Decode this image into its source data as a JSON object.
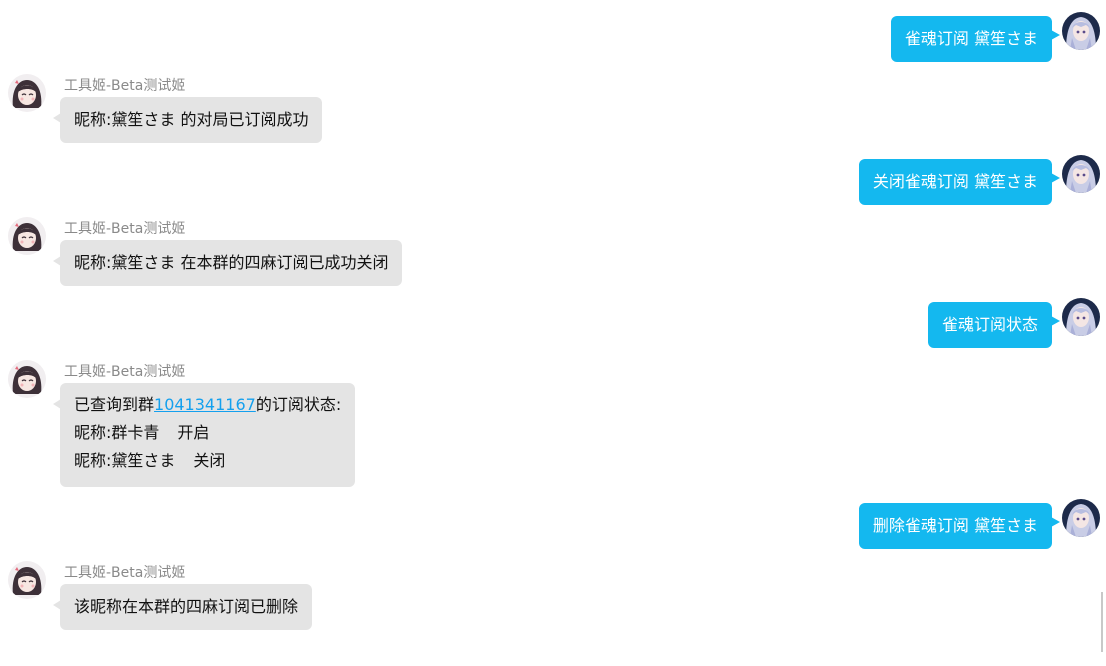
{
  "messages": [
    {
      "dir": "out",
      "text": "雀魂订阅 黛笙さま"
    },
    {
      "dir": "in",
      "sender": "工具姬-Beta测试姬",
      "text": "昵称:黛笙さま 的对局已订阅成功"
    },
    {
      "dir": "out",
      "text": "关闭雀魂订阅 黛笙さま"
    },
    {
      "dir": "in",
      "sender": "工具姬-Beta测试姬",
      "text": "昵称:黛笙さま 在本群的四麻订阅已成功关闭"
    },
    {
      "dir": "out",
      "text": "雀魂订阅状态"
    },
    {
      "dir": "in",
      "sender": "工具姬-Beta测试姬",
      "status_prefix": "已查询到群",
      "group_id": "1041341167",
      "status_suffix": "的订阅状态:",
      "entries": [
        {
          "label": "昵称:",
          "name": "群卡青",
          "state": "开启"
        },
        {
          "label": "昵称:",
          "name": "黛笙さま",
          "state": "关闭"
        }
      ]
    },
    {
      "dir": "out",
      "text": "删除雀魂订阅 黛笙さま"
    },
    {
      "dir": "in",
      "sender": "工具姬-Beta测试姬",
      "text": "该昵称在本群的四麻订阅已删除"
    }
  ],
  "colors": {
    "outgoing_bubble": "#14b8ef",
    "incoming_bubble": "#e4e4e4",
    "link": "#14a0ee"
  },
  "icons": {
    "user_avatar": "anime-girl-avatar-icon",
    "bot_avatar": "bot-girl-avatar-icon"
  }
}
